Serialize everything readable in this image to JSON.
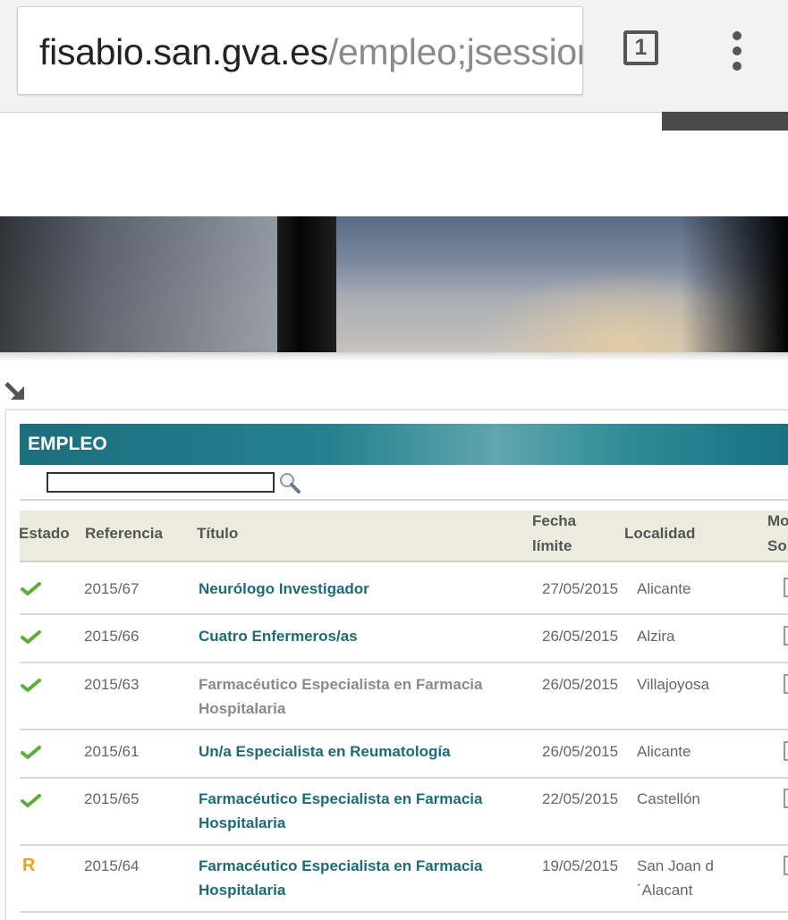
{
  "browser": {
    "url_host": "fisabio.san.gva.es",
    "url_path": "/empleo;jsessior",
    "tab_count": "1"
  },
  "section": {
    "title": "EMPLEO",
    "search_value": ""
  },
  "table": {
    "headers": {
      "estado": "Estado",
      "referencia": "Referencia",
      "titulo": "Título",
      "fecha_line1": "Fecha",
      "fecha_line2": "límite",
      "localidad": "Localidad",
      "mo_line1": "Mo",
      "mo_line2": "Sol"
    },
    "rows": [
      {
        "estado": "check",
        "referencia": "2015/67",
        "titulo": "Neurólogo Investigador",
        "titulo_style": "link",
        "fecha": "27/05/2015",
        "localidad": "Alicante"
      },
      {
        "estado": "check",
        "referencia": "2015/66",
        "titulo": "Cuatro Enfermeros/as",
        "titulo_style": "link",
        "fecha": "26/05/2015",
        "localidad": "Alzira"
      },
      {
        "estado": "check",
        "referencia": "2015/63",
        "titulo": "Farmacéutico Especialista en Farmacia Hospitalaria",
        "titulo_style": "gray",
        "fecha": "26/05/2015",
        "localidad": "Villajoyosa"
      },
      {
        "estado": "check",
        "referencia": "2015/61",
        "titulo": "Un/a Especialista en Reumatología",
        "titulo_style": "link",
        "fecha": "26/05/2015",
        "localidad": "Alicante"
      },
      {
        "estado": "check",
        "referencia": "2015/65",
        "titulo": "Farmacéutico Especialista en Farmacia Hospitalaria",
        "titulo_style": "link",
        "fecha": "22/05/2015",
        "localidad": "Castellón"
      },
      {
        "estado": "R",
        "referencia": "2015/64",
        "titulo": "Farmacéutico Especialista en Farmacia Hospitalaria",
        "titulo_style": "link",
        "fecha": "19/05/2015",
        "localidad": "San Joan d ´Alacant"
      }
    ]
  },
  "colors": {
    "accent": "#1b6b7a",
    "check_green": "#5cae3a",
    "r_orange": "#e8a020"
  }
}
